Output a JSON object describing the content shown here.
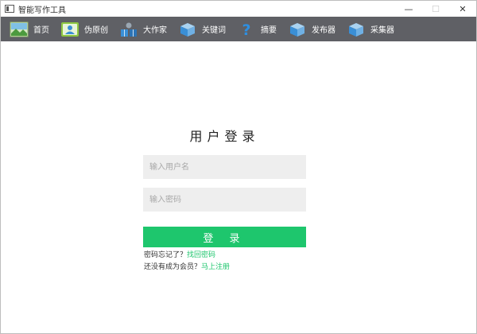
{
  "window": {
    "title": "智能写作工具",
    "controls": {
      "minimize": "—",
      "maximize": "☐",
      "close": "✕"
    }
  },
  "toolbar": {
    "items": [
      {
        "label": "首页",
        "icon": "landscape-photo-icon"
      },
      {
        "label": "伪原创",
        "icon": "user-profile-icon"
      },
      {
        "label": "大作家",
        "icon": "person-with-books-icon"
      },
      {
        "label": "关键词",
        "icon": "box-icon"
      },
      {
        "label": "摘要",
        "icon": "question-mark-icon"
      },
      {
        "label": "发布器",
        "icon": "box-icon"
      },
      {
        "label": "采集器",
        "icon": "box-icon"
      }
    ]
  },
  "login": {
    "title": "用户登录",
    "username_placeholder": "输入用户名",
    "password_placeholder": "输入密码",
    "submit_label": "登 录",
    "forgot_text": "密码忘记了？",
    "forgot_link": "找回密码",
    "register_text": "还没有成为会员？",
    "register_link": "马上注册"
  },
  "colors": {
    "toolbar_bg": "#5f6065",
    "accent_green": "#1ec66d",
    "input_bg": "#eeeeee",
    "icon_blue": "#3a8fd6"
  }
}
